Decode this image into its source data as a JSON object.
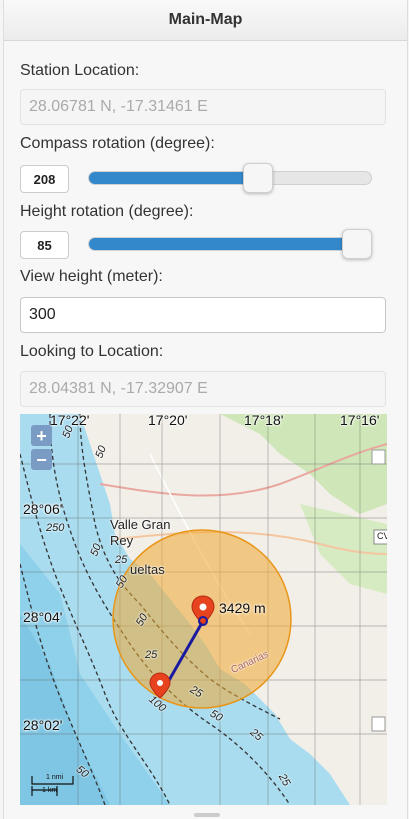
{
  "header": {
    "title": "Main-Map"
  },
  "station": {
    "label": "Station Location:",
    "value": "28.06781 N, -17.31461 E"
  },
  "compass": {
    "label": "Compass rotation (degree):",
    "value": "208",
    "fraction": 0.6
  },
  "height_rot": {
    "label": "Height rotation (degree):",
    "value": "85",
    "fraction": 0.95
  },
  "view_height": {
    "label": "View height (meter):",
    "value": "300"
  },
  "looking": {
    "label": "Looking to Location:",
    "value": "28.04381 N, -17.32907 E"
  },
  "map": {
    "zoom_in": "+",
    "zoom_out": "−",
    "lon_ticks": [
      "17°22'",
      "17°20'",
      "17°18'",
      "17°16'"
    ],
    "lat_ticks": [
      "28°06'",
      "28°04'",
      "28°02'"
    ],
    "place_valle": "Valle Gran",
    "place_rey": "Rey",
    "place_vueltas": "ueltas",
    "place_canarias": "Canarias",
    "road_label": "CV",
    "distance": "3429 m",
    "depth_labels": [
      "50",
      "250",
      "50",
      "25",
      "50",
      "50",
      "25",
      "100",
      "50",
      "25",
      "50",
      "25",
      "25",
      "50"
    ],
    "scale_nmi": "1 nmi",
    "scale_km": "1 km",
    "colors": {
      "land": "#f2efe9",
      "sea_shallow": "#b3e3f2",
      "sea_deep": "#8fd0ea",
      "circle": "#f0a830",
      "marker": "#e8431f",
      "line": "#1a1aa0"
    }
  }
}
